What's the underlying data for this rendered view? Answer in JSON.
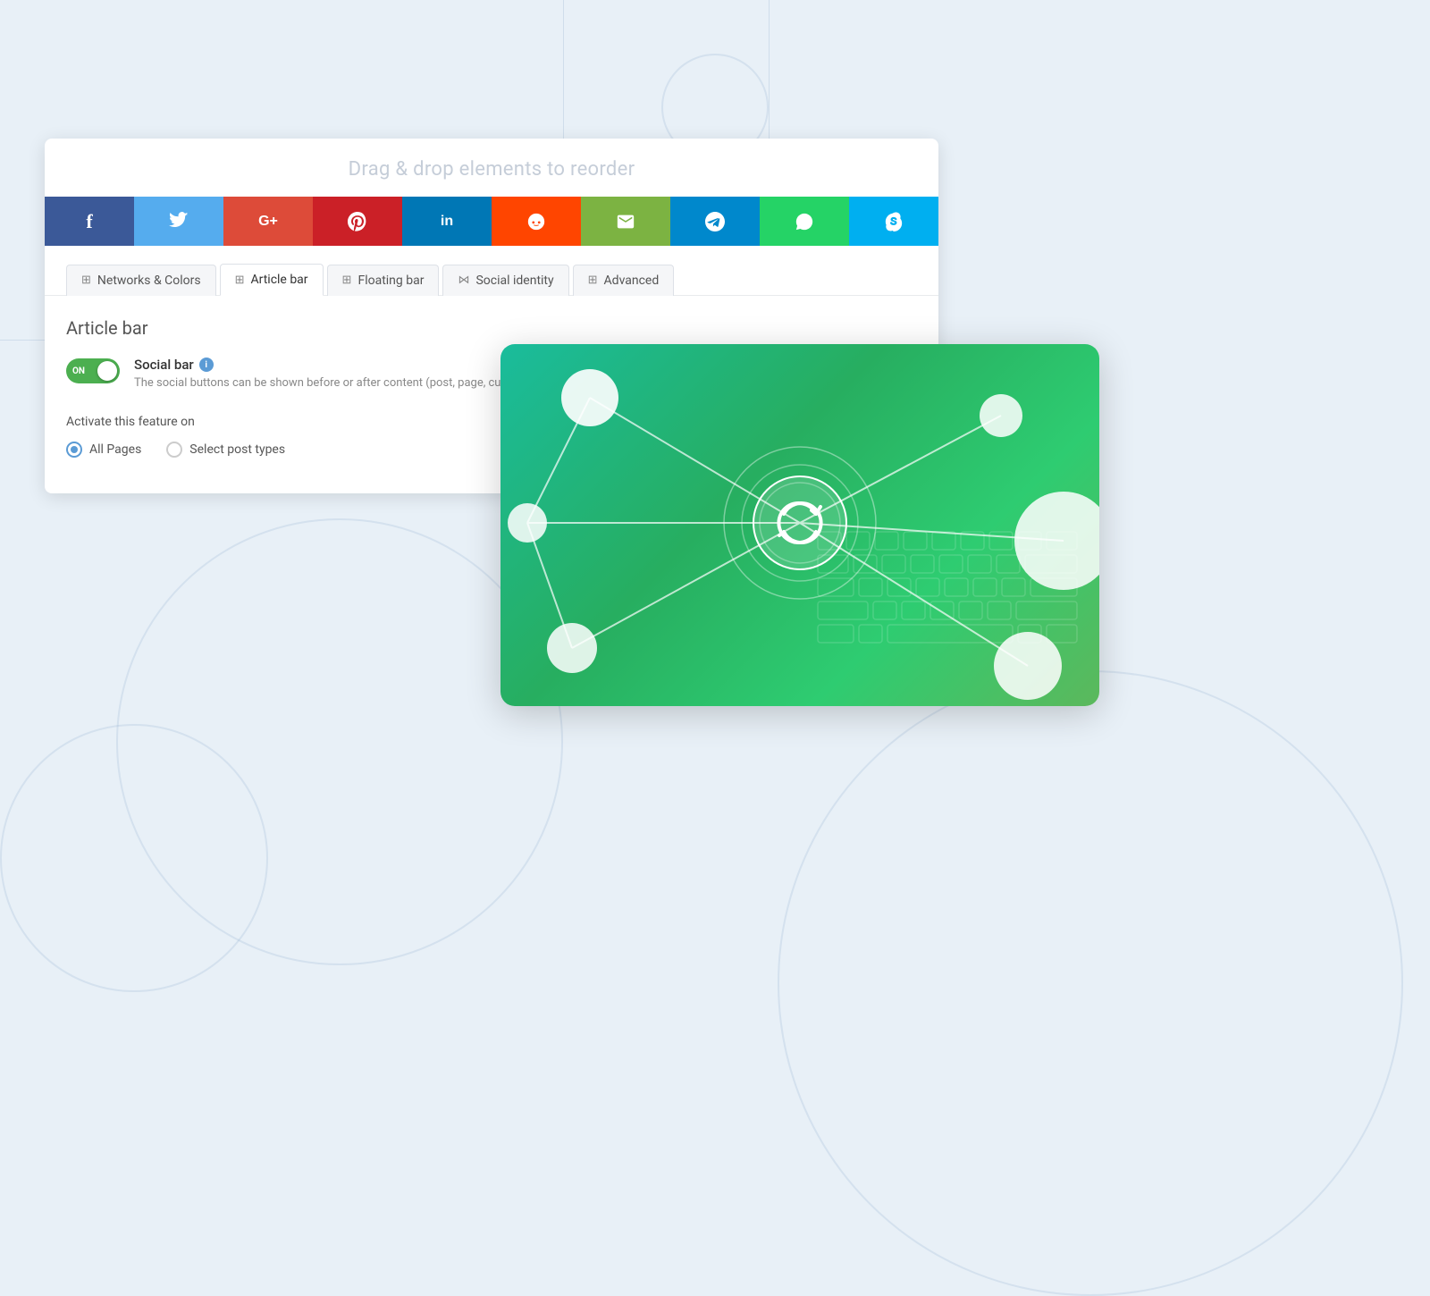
{
  "page": {
    "background": "#e8f0f7"
  },
  "header": {
    "drag_drop_label": "Drag & drop elements to reorder"
  },
  "social_buttons": [
    {
      "id": "facebook",
      "color": "#3b5998",
      "icon": "f",
      "label": "Facebook"
    },
    {
      "id": "twitter",
      "color": "#55acee",
      "icon": "t",
      "label": "Twitter"
    },
    {
      "id": "googleplus",
      "color": "#dd4b39",
      "icon": "G+",
      "label": "Google+"
    },
    {
      "id": "pinterest",
      "color": "#cb2027",
      "icon": "p",
      "label": "Pinterest"
    },
    {
      "id": "linkedin",
      "color": "#0077b5",
      "icon": "in",
      "label": "LinkedIn"
    },
    {
      "id": "reddit",
      "color": "#ff4500",
      "icon": "r",
      "label": "Reddit"
    },
    {
      "id": "email",
      "color": "#7cb342",
      "icon": "✉",
      "label": "Email"
    },
    {
      "id": "telegram",
      "color": "#0088cc",
      "icon": "✈",
      "label": "Telegram"
    },
    {
      "id": "whatsapp",
      "color": "#25d366",
      "icon": "w",
      "label": "WhatsApp"
    },
    {
      "id": "skype",
      "color": "#00aff0",
      "icon": "S",
      "label": "Skype"
    }
  ],
  "tabs": [
    {
      "id": "networks-colors",
      "label": "Networks & Colors",
      "icon": "grid",
      "active": false
    },
    {
      "id": "article-bar",
      "label": "Article bar",
      "icon": "grid",
      "active": true
    },
    {
      "id": "floating-bar",
      "label": "Floating bar",
      "icon": "grid",
      "active": false
    },
    {
      "id": "social-identity",
      "label": "Social identity",
      "icon": "share",
      "active": false
    },
    {
      "id": "advanced",
      "label": "Advanced",
      "icon": "grid",
      "active": false
    }
  ],
  "article_bar": {
    "section_title": "Article bar",
    "social_bar": {
      "label": "Social bar",
      "toggle_state": "ON",
      "description": "The social buttons can be shown before or after content (post, page, custo"
    },
    "activate_label": "Activate this feature on",
    "radio_options": [
      {
        "id": "all-pages",
        "label": "All Pages",
        "checked": true
      },
      {
        "id": "select-post-types",
        "label": "Select post types",
        "checked": false
      }
    ]
  },
  "green_card": {
    "alt": "Social sharing network visualization"
  }
}
